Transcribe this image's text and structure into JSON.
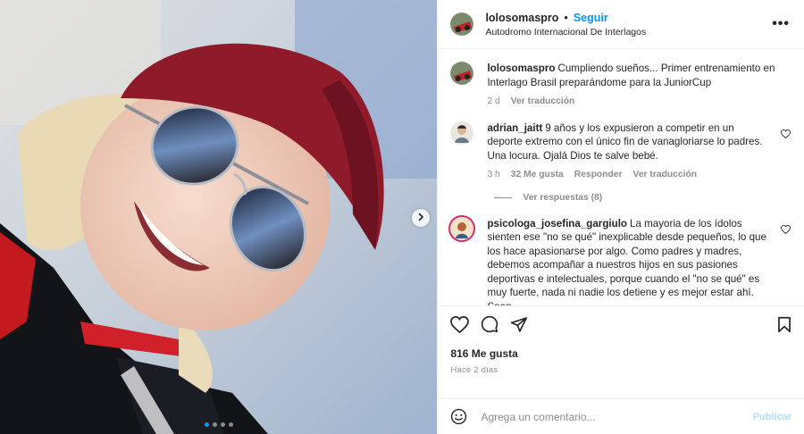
{
  "post": {
    "username": "lolosomaspro",
    "separator": "•",
    "follow_label": "Seguir",
    "location": "Autodromo Internacional De Interlagos",
    "more_label": "•••"
  },
  "caption": {
    "username": "lolosomaspro",
    "text": "Cumpliendo sueños... Primer entrenamiento en Interlago Brasil preparándome para la JuniorCup",
    "time": "2 d",
    "translate": "Ver traducción"
  },
  "comments": [
    {
      "username": "adrian_jaitt",
      "text": "9 años y los expusieron a competir en un deporte extremo con el único fin de vanagloriarse lo padres. Una locura. Ojalá Dios te salve bebé.",
      "time": "3 h",
      "likes": "32 Me gusta",
      "reply": "Responder",
      "translate": "Ver traducción",
      "view_replies": "Ver respuestas (8)"
    },
    {
      "username": "psicologa_josefina_gargiulo",
      "text": "La mayoria de los ídolos sienten ese \"no se qué\" inexplicable desde pequeños, lo que los hace apasionarse por algo. Como padres y madres, debemos acompañar a nuestros hijos en sus pasiones deportivas e intelectuales, porque cuando el \"no se qué\" es muy fuerte, nada ni nadie los detiene y es mejor estar ahí. Sean"
    }
  ],
  "engagement": {
    "likes": "816 Me gusta",
    "ago": "Hace 2 días"
  },
  "composer": {
    "placeholder": "Agrega un comentario...",
    "publish": "Publicar"
  },
  "carousel": {
    "dots": 4,
    "active": 0
  },
  "colors": {
    "accent": "#0095f6",
    "muted": "#8e8e8e",
    "publish_disabled": "#b2dffc"
  },
  "icons": [
    "chevron-right-icon",
    "heart-icon",
    "comment-icon",
    "share-icon",
    "bookmark-icon",
    "emoji-icon",
    "more-icon"
  ]
}
